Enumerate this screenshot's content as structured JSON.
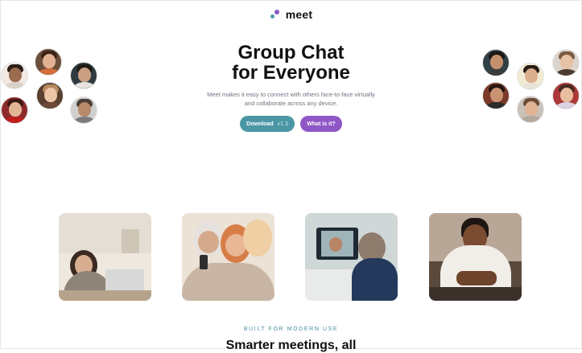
{
  "brand": {
    "name": "meet",
    "colors": {
      "teal": "#4b9aa9",
      "purple": "#8a5bc7"
    }
  },
  "hero": {
    "title_line1": "Group Chat",
    "title_line2": "for Everyone",
    "subtitle_line1": "Meet makes it easy to connect with others face-to-face virtually",
    "subtitle_line2": "and collaborate across any device.",
    "download_label": "Download",
    "download_version": "v1.3",
    "what_label": "What is it?"
  },
  "avatars_left": [
    {
      "label": "person-1"
    },
    {
      "label": "person-2"
    },
    {
      "label": "person-3"
    },
    {
      "label": "person-4"
    },
    {
      "label": "person-5"
    },
    {
      "label": "person-6"
    }
  ],
  "avatars_right": [
    {
      "label": "person-7"
    },
    {
      "label": "person-8"
    },
    {
      "label": "person-9"
    },
    {
      "label": "person-10"
    },
    {
      "label": "person-11"
    },
    {
      "label": "person-12"
    }
  ],
  "photos": [
    {
      "label": "woman-on-laptop-call"
    },
    {
      "label": "women-looking-at-phone"
    },
    {
      "label": "man-on-video-call"
    },
    {
      "label": "man-using-phone"
    }
  ],
  "section": {
    "kicker": "BUILT FOR MODERN USE",
    "title": "Smarter meetings, all"
  }
}
